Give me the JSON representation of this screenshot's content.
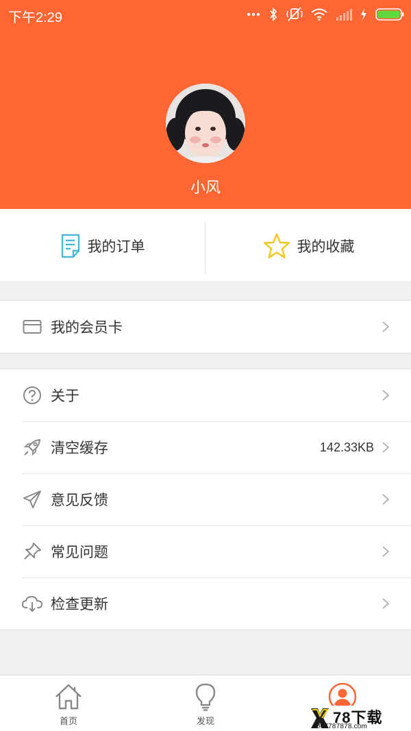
{
  "status_bar": {
    "time": "下午2:29",
    "icons": [
      "more-icon",
      "bluetooth-icon",
      "mute-icon",
      "wifi-icon",
      "signal-icon",
      "charging-icon",
      "battery-icon"
    ]
  },
  "profile": {
    "username": "小风"
  },
  "quick_actions": [
    {
      "label": "我的订单",
      "icon": "order-icon"
    },
    {
      "label": "我的收藏",
      "icon": "star-icon"
    }
  ],
  "group1": [
    {
      "label": "我的会员卡",
      "icon": "card-icon"
    }
  ],
  "group2": [
    {
      "label": "关于",
      "icon": "help-icon",
      "value": ""
    },
    {
      "label": "清空缓存",
      "icon": "rocket-icon",
      "value": "142.33KB"
    },
    {
      "label": "意见反馈",
      "icon": "send-icon",
      "value": ""
    },
    {
      "label": "常见问题",
      "icon": "pin-icon",
      "value": ""
    },
    {
      "label": "检查更新",
      "icon": "cloud-download-icon",
      "value": ""
    }
  ],
  "tabs": [
    {
      "label": "首页",
      "icon": "home-icon"
    },
    {
      "label": "发现",
      "icon": "bulb-icon"
    },
    {
      "label": "",
      "icon": "user-icon",
      "active": true
    }
  ],
  "watermark": {
    "title": "78下载",
    "url": "4007787878.com"
  },
  "colors": {
    "accent": "#ff6633",
    "order_icon": "#4ab8d8",
    "star_icon": "#f5c518"
  }
}
